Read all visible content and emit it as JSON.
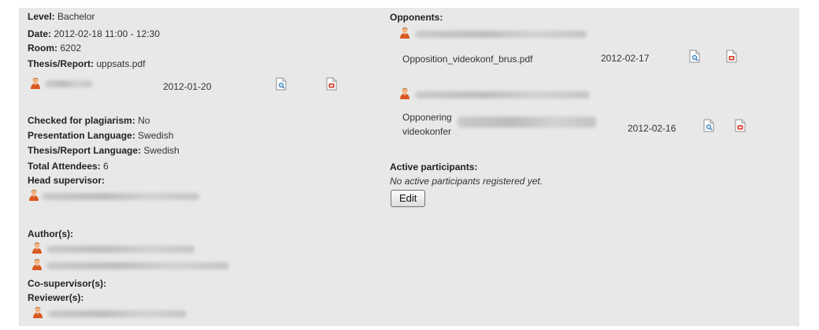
{
  "left": {
    "level": {
      "label": "Level:",
      "value": "Bachelor"
    },
    "date": {
      "label": "Date:",
      "value": "2012-02-18 11:00 - 12:30"
    },
    "room": {
      "label": "Room:",
      "value": "6202"
    },
    "thesis": {
      "label": "Thesis/Report:",
      "value": "uppsats.pdf"
    },
    "submission_date": "2012-01-20",
    "plagiarism": {
      "label": "Checked for plagiarism:",
      "value": "No"
    },
    "presentation_language": {
      "label": "Presentation Language:",
      "value": "Swedish"
    },
    "report_language": {
      "label": "Thesis/Report Language:",
      "value": "Swedish"
    },
    "attendees": {
      "label": "Total Attendees:",
      "value": "6"
    },
    "head_supervisor_label": "Head supervisor:",
    "authors_label": "Author(s):",
    "co_supervisor_label": "Co-supervisor(s):",
    "reviewer_label": "Reviewer(s):"
  },
  "right": {
    "opponents_label": "Opponents:",
    "opposition1": {
      "file": "Opposition_videokonf_brus.pdf",
      "date": "2012-02-17"
    },
    "opposition2": {
      "file_line1": "Opponering",
      "file_line2": "videokonfer",
      "date": "2012-02-16"
    },
    "active_label": "Active participants:",
    "active_note": "No active participants registered yet.",
    "edit_label": "Edit"
  },
  "colors": {
    "panel": "#e8e8e8",
    "person_icon": "#d9581f"
  }
}
